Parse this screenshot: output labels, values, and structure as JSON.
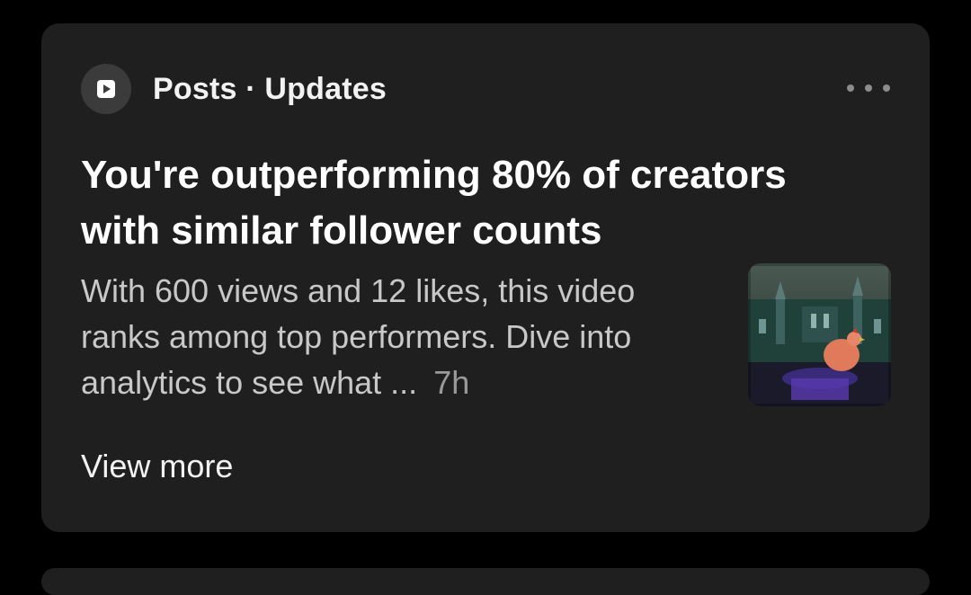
{
  "notification": {
    "source": "Posts · Updates",
    "app_icon": "play-icon",
    "menu_icon": "more-horizontal-icon",
    "headline": "You're outperforming 80% of creators with similar follower counts",
    "body": "With 600 views and 12 likes, this video ranks among top performers. Dive into analytics to see what ...",
    "timestamp": "7h",
    "thumbnail_description": "video-thumbnail",
    "view_more_label": "View more"
  },
  "colors": {
    "background": "#000000",
    "card": "#1f1f1f",
    "headline": "#ffffff",
    "body": "#c8c8c8",
    "timestamp": "#9a9a9a"
  }
}
